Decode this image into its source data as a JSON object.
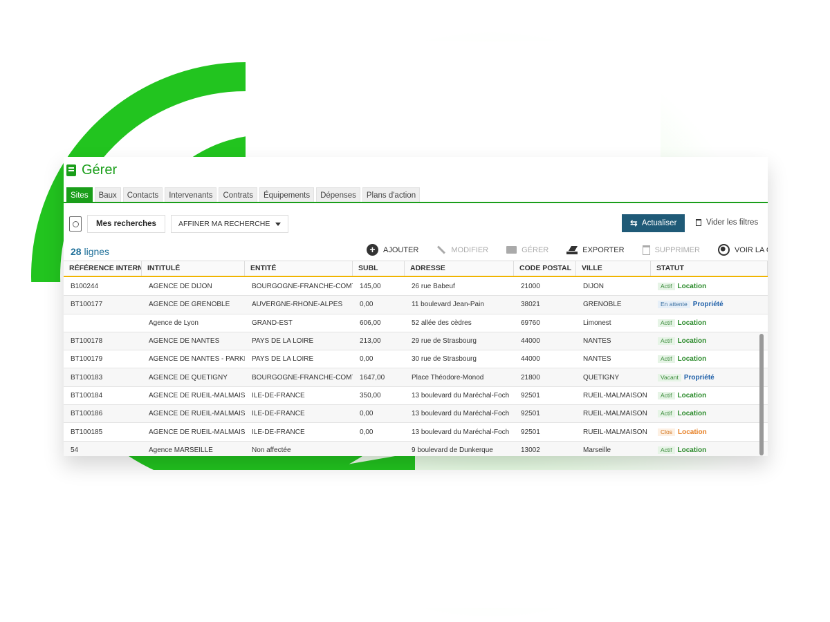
{
  "app": {
    "title": "Gérer"
  },
  "tabs": [
    {
      "label": "Sites",
      "active": true
    },
    {
      "label": "Baux"
    },
    {
      "label": "Contacts"
    },
    {
      "label": "Intervenants"
    },
    {
      "label": "Contrats"
    },
    {
      "label": "Équipements"
    },
    {
      "label": "Dépenses"
    },
    {
      "label": "Plans d'action"
    }
  ],
  "search": {
    "saved_label": "Mes recherches",
    "refine_label": "AFFINER MA RECHERCHE"
  },
  "toolbar": {
    "refresh_label": "Actualiser",
    "clear_filters_label": "Vider les filtres"
  },
  "row_count": {
    "number": "28",
    "unit": "lignes"
  },
  "actions": {
    "add": "AJOUTER",
    "edit": "MODIFIER",
    "manage": "GÉRER",
    "export": "EXPORTER",
    "delete": "SUPPRIMER",
    "map": "VOIR LA CARTE"
  },
  "table": {
    "columns": [
      "RÉFÉRENCE INTERNE",
      "INTITULÉ",
      "ENTITÉ",
      "SUBL",
      "ADRESSE",
      "CODE POSTAL",
      "VILLE",
      "STATUT"
    ],
    "rows": [
      {
        "ref": "B100244",
        "name": "AGENCE DE DIJON",
        "entity": "BOURGOGNE-FRANCHE-COMTE",
        "subl": "145,00",
        "address": "26 rue Babeuf",
        "zip": "21000",
        "city": "DIJON",
        "status": "Actif",
        "type": "Location"
      },
      {
        "ref": "BT100177",
        "name": "AGENCE DE GRENOBLE",
        "entity": "AUVERGNE-RHONE-ALPES",
        "subl": "0,00",
        "address": "11 boulevard Jean-Pain",
        "zip": "38021",
        "city": "GRENOBLE",
        "status": "En attente",
        "type": "Propriété"
      },
      {
        "ref": "",
        "name": "Agence de Lyon",
        "entity": "GRAND-EST",
        "subl": "606,00",
        "address": "52 allée des cèdres",
        "zip": "69760",
        "city": "Limonest",
        "status": "Actif",
        "type": "Location"
      },
      {
        "ref": "BT100178",
        "name": "AGENCE DE NANTES",
        "entity": "PAYS DE LA LOIRE",
        "subl": "213,00",
        "address": "29 rue de Strasbourg",
        "zip": "44000",
        "city": "NANTES",
        "status": "Actif",
        "type": "Location"
      },
      {
        "ref": "BT100179",
        "name": "AGENCE DE NANTES - PARKING",
        "entity": "PAYS DE LA LOIRE",
        "subl": "0,00",
        "address": "30 rue de Strasbourg",
        "zip": "44000",
        "city": "NANTES",
        "status": "Actif",
        "type": "Location"
      },
      {
        "ref": "BT100183",
        "name": "AGENCE DE QUETIGNY",
        "entity": "BOURGOGNE-FRANCHE-COMTE",
        "subl": "1647,00",
        "address": "Place Théodore-Monod",
        "zip": "21800",
        "city": "QUETIGNY",
        "status": "Vacant",
        "type": "Propriété"
      },
      {
        "ref": "BT100184",
        "name": "AGENCE DE RUEIL-MALMAISON",
        "entity": "ILE-DE-FRANCE",
        "subl": "350,00",
        "address": "13 boulevard du Maréchal-Foch",
        "zip": "92501",
        "city": "RUEIL-MALMAISON",
        "status": "Actif",
        "type": "Location"
      },
      {
        "ref": "BT100186",
        "name": "AGENCE DE RUEIL-MALMAISON - E",
        "entity": "ILE-DE-FRANCE",
        "subl": "0,00",
        "address": "13 boulevard du Maréchal-Foch",
        "zip": "92501",
        "city": "RUEIL-MALMAISON",
        "status": "Actif",
        "type": "Location"
      },
      {
        "ref": "BT100185",
        "name": "AGENCE DE RUEIL-MALMAISON - F",
        "entity": "ILE-DE-FRANCE",
        "subl": "0,00",
        "address": "13 boulevard du Maréchal-Foch",
        "zip": "92501",
        "city": "RUEIL-MALMAISON",
        "status": "Clos",
        "type": "Location"
      },
      {
        "ref": "54",
        "name": "Agence MARSEILLE",
        "entity": "Non affectée",
        "subl": "",
        "address": "9 boulevard de Dunkerque",
        "zip": "13002",
        "city": "Marseille",
        "status": "Actif",
        "type": "Location"
      }
    ]
  },
  "colors": {
    "brand_green": "#1a9e1a",
    "deco_green": "#22c41f",
    "refresh_button": "#1f5a77",
    "header_underline": "#f0b400",
    "row_count": "#1e6f99"
  }
}
